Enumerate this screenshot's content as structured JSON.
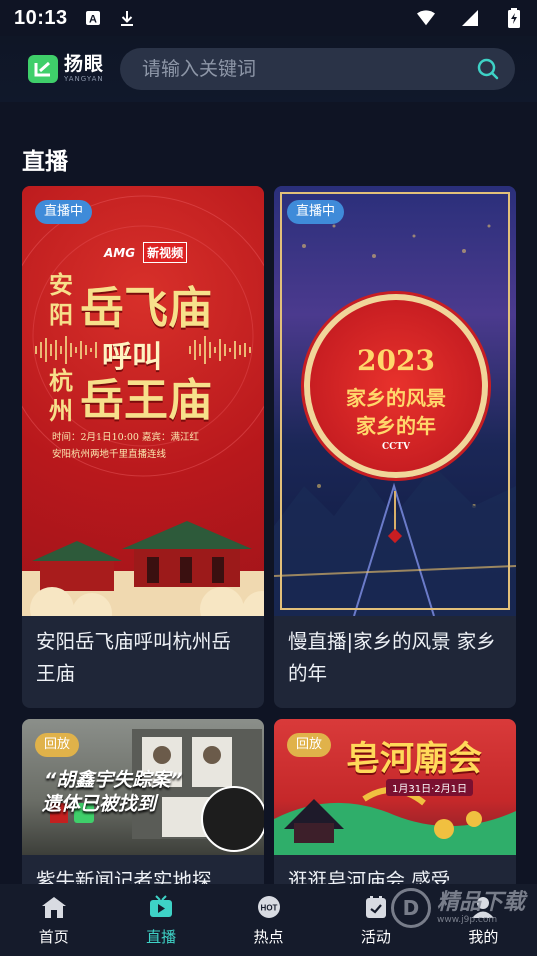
{
  "status_bar": {
    "time": "10:13",
    "icons": [
      "a-notification-icon",
      "download-icon",
      "wifi-icon",
      "signal-icon",
      "battery-charging-icon"
    ]
  },
  "header": {
    "logo_cn": "扬眼",
    "logo_en": "YANGYAN",
    "search_placeholder": "请输入关键词"
  },
  "section": {
    "title": "直播"
  },
  "cards": [
    {
      "badge": "直播中",
      "title": "安阳岳飞庙呼叫杭州岳王庙",
      "art": {
        "brand1": "AMG",
        "brand2": "新视频",
        "line_left": "安阳",
        "line_left2": "杭州",
        "big1": "岳飞庙",
        "mid": "呼叫",
        "big2": "岳王庙",
        "info1": "时间：2月1日10:00    嘉宾：满江红",
        "info2": "安阳杭州两地千里直播连线"
      }
    },
    {
      "badge": "直播中",
      "title": "慢直播|家乡的风景 家乡的年",
      "art": {
        "year": "2023",
        "line1": "家乡的风景",
        "line2": "家乡的年",
        "brand": "CCTV"
      }
    },
    {
      "badge": "回放",
      "title": "紫牛新闻记者实地探",
      "art": {
        "headline1": "“胡鑫宇失踪案”",
        "headline2": "遗体已被找到"
      }
    },
    {
      "badge": "回放",
      "title": "逛逛皂河庙会 感受",
      "art": {
        "headline": "皂河廟会",
        "date": "1月31日·2月1日"
      }
    }
  ],
  "tabbar": {
    "tabs": [
      {
        "label": "首页",
        "icon": "home-icon",
        "active": false
      },
      {
        "label": "直播",
        "icon": "tv-icon",
        "active": true
      },
      {
        "label": "热点",
        "icon": "hot-icon",
        "active": false
      },
      {
        "label": "活动",
        "icon": "activity-icon",
        "active": false
      },
      {
        "label": "我的",
        "icon": "profile-icon",
        "active": false
      }
    ]
  },
  "watermark": {
    "text": "精品下载",
    "url": "www.j9p.com"
  },
  "colors": {
    "background": "#0f1424",
    "card": "#1f2638",
    "accent": "#3ed2c6",
    "logo_green": "#3fcf6a",
    "live_badge": "#3f8bd9",
    "replay_badge": "#e0b24a"
  }
}
